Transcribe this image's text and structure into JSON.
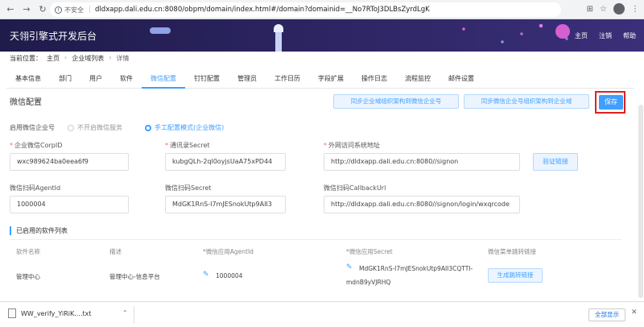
{
  "browser": {
    "security_label": "不安全",
    "url": "dldxapp.dali.edu.cn:8080/obpm/domain/index.html#/domain?domainid=__No7RToJ3DLBsZyrdLgK"
  },
  "header": {
    "app_title": "天翎引擎式开发后台",
    "links": [
      "主页",
      "注销",
      "帮助"
    ]
  },
  "breadcrumb": {
    "label": "当前位置：",
    "items": [
      "主页",
      "企业域列表",
      "详情"
    ]
  },
  "tabs": [
    "基本信息",
    "部门",
    "用户",
    "软件",
    "微信配置",
    "钉钉配置",
    "管理员",
    "工作日历",
    "字段扩展",
    "操作日志",
    "流程监控",
    "邮件设置"
  ],
  "active_tab": "微信配置",
  "section": {
    "title": "微信配置",
    "sync_to_wechat": "同步企业域组织架构到微信企业号",
    "sync_from_wechat": "同步微信企业号组织架构到企业域",
    "save": "保存"
  },
  "form": {
    "enable_label": "启用微信企业号",
    "radio_off": "不开启微信服务",
    "radio_manual": "手工配置模式(企业微信)",
    "corpid_label": "企业微信CorpID",
    "corpid_value": "wxc989624ba0eea6f9",
    "secret_label": "通讯录Secret",
    "secret_value": "kubgQLh-2ql0oyjsUaA75xPD44",
    "external_url_label": "外网访问系统地址",
    "external_url_value": "http://dldxapp.dali.edu.cn:8080//signon",
    "verify_button": "验证链接",
    "agentid_label": "微信扫码AgentId",
    "agentid_value": "1000004",
    "scan_secret_label": "微信扫码Secret",
    "scan_secret_value": "MdGK1RnS-I7mJESnokUtp9AII3",
    "callback_label": "微信扫码CallbackUrl",
    "callback_value": "http://dldxapp.dali.edu.cn:8080//signon/login/wxqrcode"
  },
  "software_list": {
    "title": "已启用的软件列表",
    "headers": [
      "软件名称",
      "描述",
      "*微信应用AgentId",
      "*微信应用Secret",
      "微信菜单跳转链接"
    ],
    "rows": [
      {
        "name": "管理中心",
        "description": "管理中心-信息平台",
        "agentid": "1000004",
        "secret_line1": "MdGK1RnS-I7mJESnokUtp9AII3CQTTI-",
        "secret_line2": "mdnB9yVJRHQ",
        "link_button": "生成跳转链接"
      }
    ]
  },
  "downloads": {
    "file": "WW_verify_YiRiK....txt",
    "show_all": "全部显示"
  },
  "colors": {
    "accent": "#409eff",
    "header_bg": "#2b2460",
    "highlight": "#e02020"
  }
}
